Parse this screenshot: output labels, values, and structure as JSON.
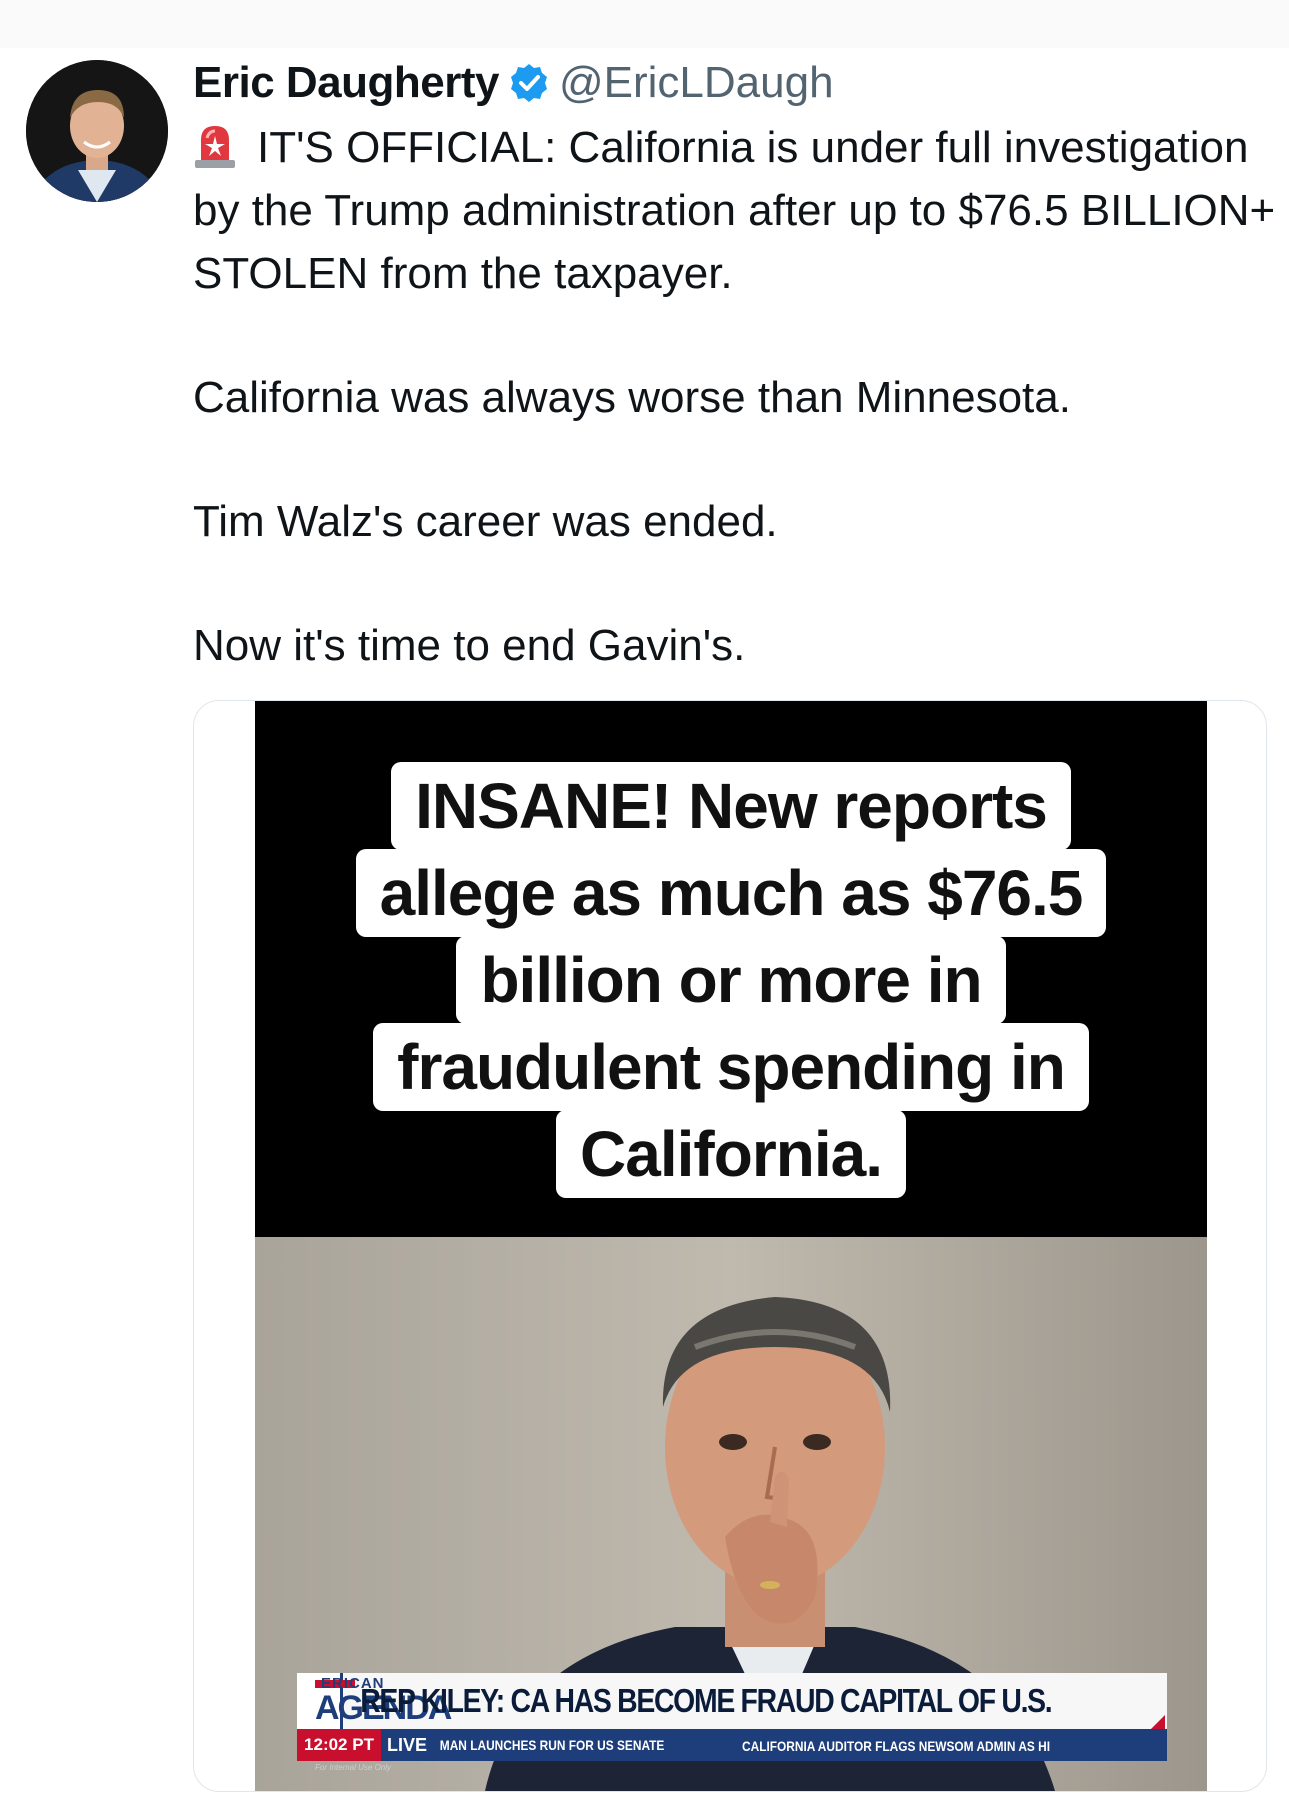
{
  "author": {
    "name": "Eric Daugherty",
    "handle": "@EricLDaugh",
    "verified": true,
    "avatar_icon": "profile-photo"
  },
  "tweet": {
    "siren_icon": "police-light-emoji",
    "paragraphs": [
      "IT'S OFFICIAL: California is under full investigation by the Trump administration after up to $76.5 BILLION+ STOLEN from the taxpayer.",
      "California was always worse than Minnesota.",
      "Tim Walz's career was ended.",
      "Now it's time to end Gavin's."
    ]
  },
  "media": {
    "type": "video",
    "caption_lines": [
      "INSANE! New reports",
      "allege as much as $76.5",
      "billion or more in",
      "fraudulent spending in",
      "California."
    ],
    "chyron": {
      "brand_top": "ERICAN",
      "brand_bottom": "AGENDA",
      "headline": "REP KILEY: CA HAS BECOME FRAUD CAPITAL OF U.S.",
      "time": "12:02 PT",
      "live": "LIVE",
      "ticker_1": "MAN LAUNCHES RUN FOR US SENATE",
      "ticker_2": "CALIFORNIA AUDITOR FLAGS NEWSOM ADMIN AS HI",
      "fine_print": "For Internal Use Only"
    },
    "mute_icon": "volume-muted-icon",
    "colors": {
      "chyron_navy": "#1d3e7a",
      "chyron_red": "#c8102e",
      "verified_blue": "#1d9bf0"
    }
  }
}
